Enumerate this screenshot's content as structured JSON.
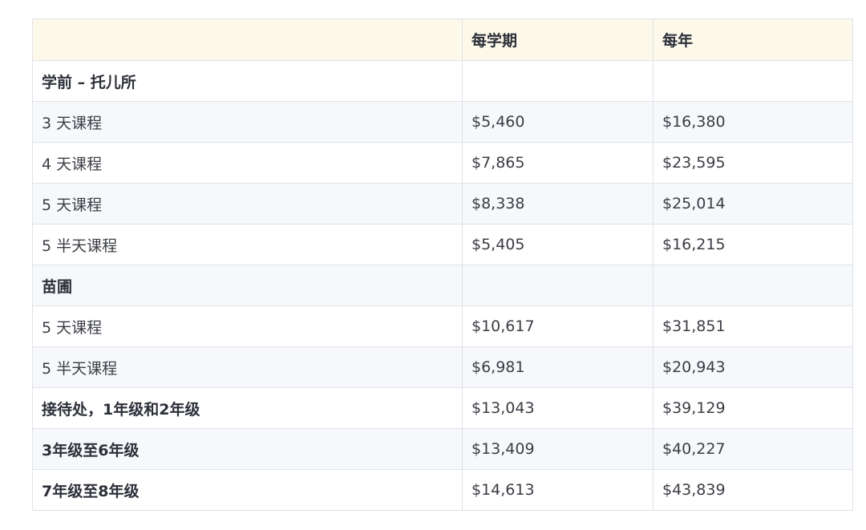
{
  "table": {
    "headers": [
      "",
      "每学期",
      "每年"
    ],
    "rows": [
      {
        "label": "学前 – 托儿所",
        "per_term": "",
        "per_year": "",
        "bold": true
      },
      {
        "label": "3 天课程",
        "per_term": "$5,460",
        "per_year": "$16,380",
        "bold": false
      },
      {
        "label": "4 天课程",
        "per_term": "$7,865",
        "per_year": "$23,595",
        "bold": false
      },
      {
        "label": "5 天课程",
        "per_term": "$8,338",
        "per_year": "$25,014",
        "bold": false
      },
      {
        "label": "5 半天课程",
        "per_term": "$5,405",
        "per_year": "$16,215",
        "bold": false
      },
      {
        "label": "苗圃",
        "per_term": "",
        "per_year": "",
        "bold": true
      },
      {
        "label": "5 天课程",
        "per_term": "$10,617",
        "per_year": "$31,851",
        "bold": false
      },
      {
        "label": "5 半天课程",
        "per_term": "$6,981",
        "per_year": "$20,943",
        "bold": false
      },
      {
        "label": "接待处，1年级和2年级",
        "per_term": "$13,043",
        "per_year": "$39,129",
        "bold": true
      },
      {
        "label": "3年级至6年级",
        "per_term": "$13,409",
        "per_year": "$40,227",
        "bold": true
      },
      {
        "label": "7年级至8年级",
        "per_term": "$14,613",
        "per_year": "$43,839",
        "bold": true
      }
    ]
  }
}
